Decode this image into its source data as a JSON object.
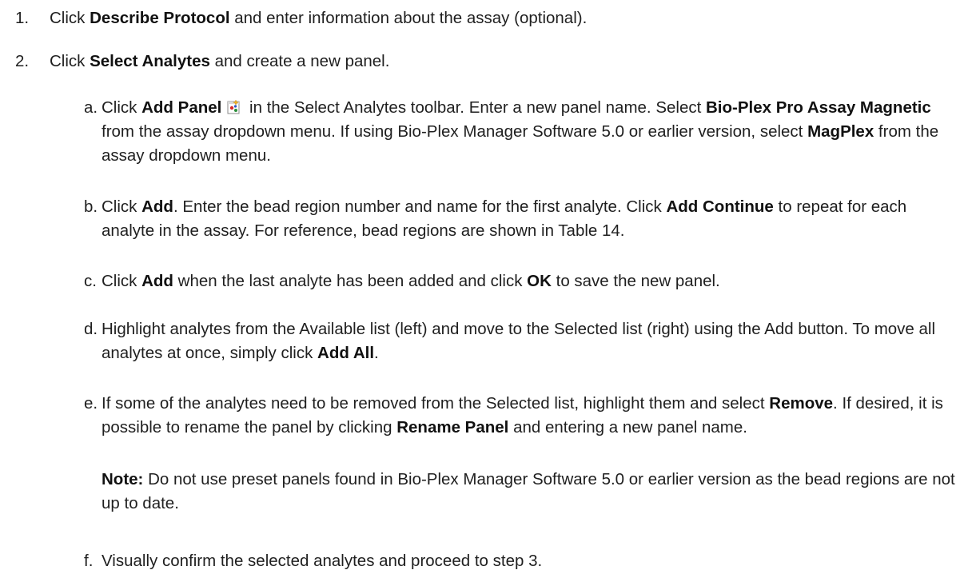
{
  "step1": {
    "num": "1.",
    "pre": "Click ",
    "bold": "Describe Protocol",
    "post": " and enter information about the assay (optional)."
  },
  "step2": {
    "num": "2.",
    "pre": "Click ",
    "bold": "Select Analytes",
    "post": " and create a new panel."
  },
  "sub_a": {
    "letter": "a.",
    "t1": "Click ",
    "b1": "Add Panel",
    "icon": "add-panel-icon",
    "t2": " in the Select Analytes toolbar. Enter a new panel name. Select ",
    "b2": "Bio-Plex Pro Assay Magnetic",
    "t3": " from the assay dropdown menu. If using Bio-Plex Manager Software 5.0 or earlier version, select ",
    "b3": "MagPlex",
    "t4": " from the assay dropdown menu."
  },
  "sub_b": {
    "letter": "b.",
    "t1": "Click ",
    "b1": "Add",
    "t2": ". Enter the bead region number and name for the first analyte. Click ",
    "b2": "Add Continue",
    "t3": " to repeat for each analyte in the assay. For reference, bead regions are shown in Table 14."
  },
  "sub_c": {
    "letter": "c.",
    "t1": "Click ",
    "b1": "Add",
    "t2": " when the last analyte has been added and click ",
    "b2": "OK",
    "t3": " to save the new panel."
  },
  "sub_d": {
    "letter": "d.",
    "t1": "Highlight analytes from the Available list (left) and move to the Selected list (right) using the Add button. To move all analytes at once, simply click ",
    "b1": "Add All",
    "t2": "."
  },
  "sub_e": {
    "letter": "e.",
    "t1": "If some of the analytes need to be removed from the Selected list, highlight them and select ",
    "b1": "Remove",
    "t2": ". If desired, it is possible to rename the panel by clicking ",
    "b2": "Rename Panel",
    "t3": " and entering a new panel name."
  },
  "note": {
    "label": "Note:",
    "text": " Do not use preset panels found in Bio-Plex Manager Software 5.0 or earlier version as the bead regions are not up to date."
  },
  "sub_f": {
    "letter": "f.",
    "text": "Visually confirm the selected analytes and proceed to step 3."
  }
}
